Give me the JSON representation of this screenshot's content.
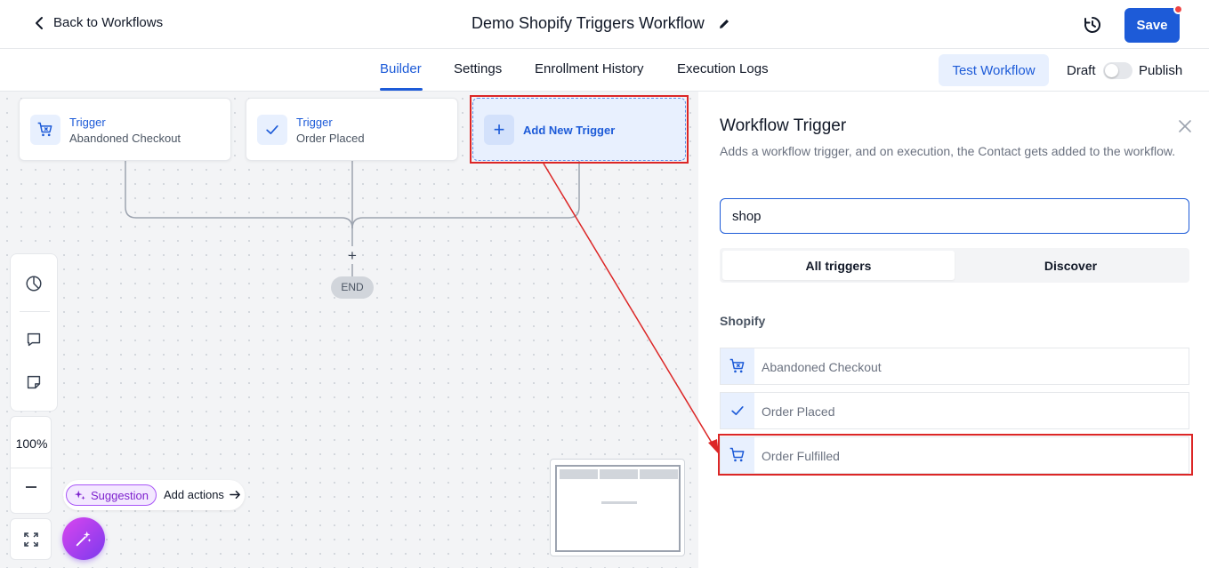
{
  "header": {
    "back_label": "Back to Workflows",
    "title": "Demo Shopify Triggers Workflow",
    "save_label": "Save"
  },
  "tabs": [
    {
      "label": "Builder",
      "active": true
    },
    {
      "label": "Settings",
      "active": false
    },
    {
      "label": "Enrollment History",
      "active": false
    },
    {
      "label": "Execution Logs",
      "active": false
    }
  ],
  "toolbar": {
    "test_label": "Test Workflow",
    "draft_label": "Draft",
    "publish_label": "Publish",
    "published": false
  },
  "canvas": {
    "triggers": [
      {
        "type_label": "Trigger",
        "name": "Abandoned Checkout",
        "icon": "cart-icon"
      },
      {
        "type_label": "Trigger",
        "name": "Order Placed",
        "icon": "check-icon"
      }
    ],
    "add_trigger_label": "Add New Trigger",
    "end_label": "END",
    "zoom": "100%",
    "suggestion_label": "Suggestion",
    "add_actions_label": "Add actions"
  },
  "panel": {
    "title": "Workflow Trigger",
    "description": "Adds a workflow trigger, and on execution, the Contact gets added to the workflow.",
    "search_value": "shop",
    "segments": [
      "All triggers",
      "Discover"
    ],
    "group_label": "Shopify",
    "items": [
      {
        "label": "Abandoned Checkout",
        "icon": "cart-icon"
      },
      {
        "label": "Order Placed",
        "icon": "check-icon"
      },
      {
        "label": "Order Fulfilled",
        "icon": "cart-icon"
      }
    ]
  },
  "colors": {
    "primary": "#1d5bd8",
    "highlight": "#dc2626",
    "suggestion": "#7e22ce"
  }
}
